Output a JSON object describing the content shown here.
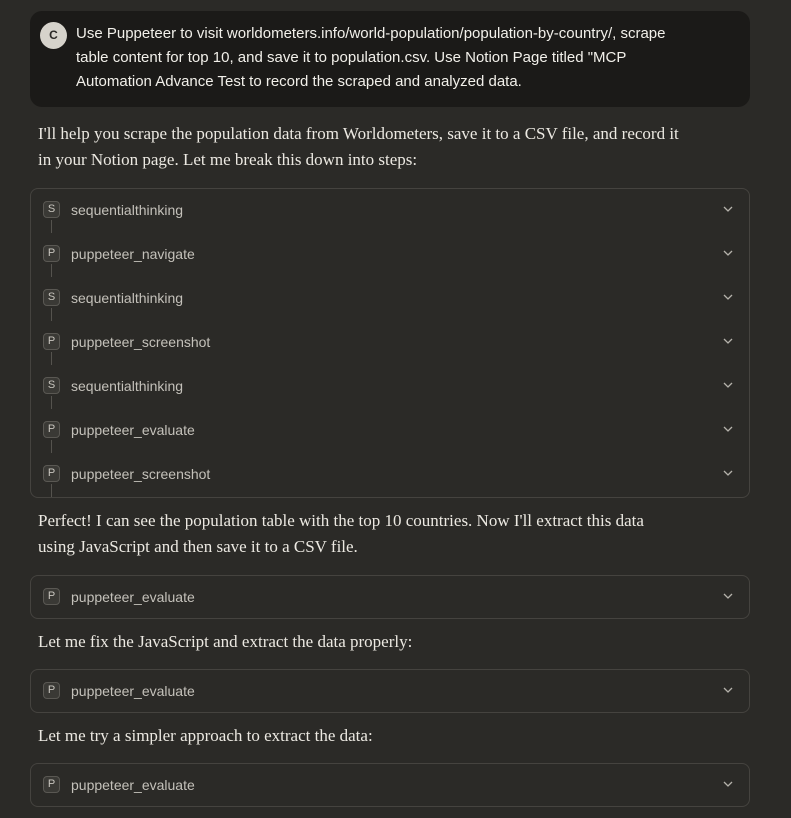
{
  "user_message": {
    "avatar_initial": "C",
    "text": "Use Puppeteer to visit worldometers.info/world-population/population-by-country/, scrape\ntable content for top 10, and save it to population.csv. Use Notion Page titled \"MCP\nAutomation Advance Test to record the scraped and analyzed data."
  },
  "intro": "I'll help you scrape the population data from Worldometers, save it to a CSV file, and record it\nin your Notion page. Let me break this down into steps:",
  "tool_group_1": [
    {
      "badge": "S",
      "name": "sequentialthinking"
    },
    {
      "badge": "P",
      "name": "puppeteer_navigate"
    },
    {
      "badge": "S",
      "name": "sequentialthinking"
    },
    {
      "badge": "P",
      "name": "puppeteer_screenshot"
    },
    {
      "badge": "S",
      "name": "sequentialthinking"
    },
    {
      "badge": "P",
      "name": "puppeteer_evaluate"
    },
    {
      "badge": "P",
      "name": "puppeteer_screenshot"
    }
  ],
  "para_2": "Perfect! I can see the population table with the top 10 countries. Now I'll extract this data\nusing JavaScript and then save it to a CSV file.",
  "tool_2": {
    "badge": "P",
    "name": "puppeteer_evaluate"
  },
  "para_3": "Let me fix the JavaScript and extract the data properly:",
  "tool_3": {
    "badge": "P",
    "name": "puppeteer_evaluate"
  },
  "para_4": "Let me try a simpler approach to extract the data:",
  "tool_4": {
    "badge": "P",
    "name": "puppeteer_evaluate"
  },
  "colors": {
    "background": "#2b2a27",
    "user_bubble": "#1b1a18",
    "border": "#45433f"
  }
}
